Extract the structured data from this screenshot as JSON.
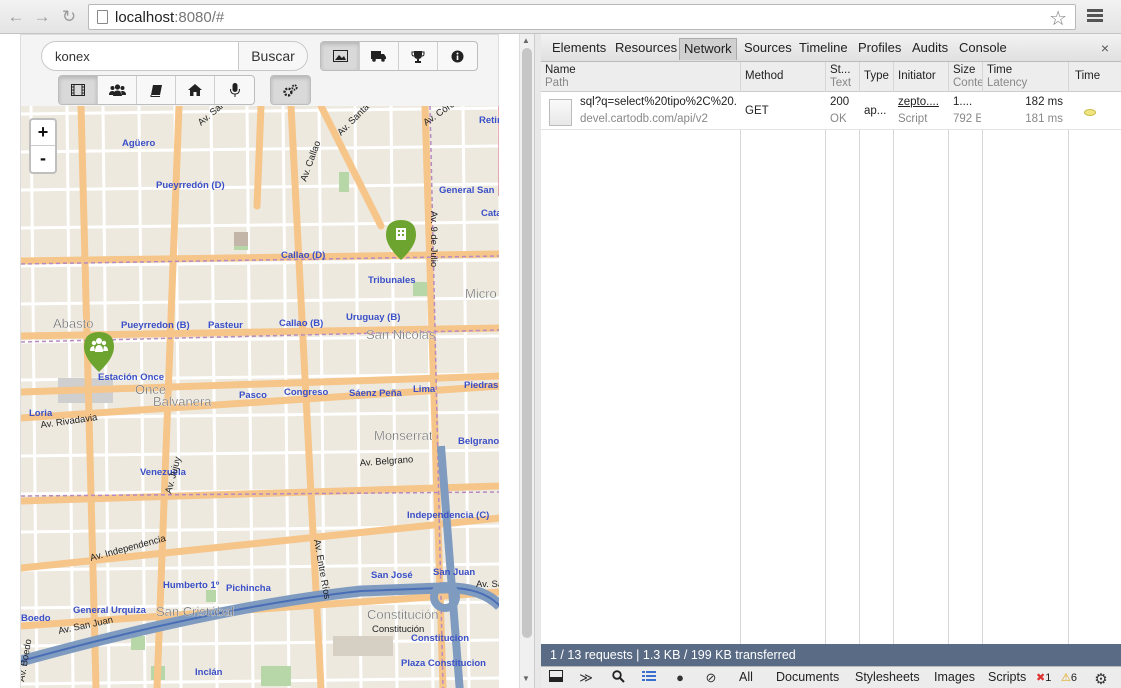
{
  "browser": {
    "url_host": "localhost",
    "url_rest": ":8080/#",
    "icons": [
      "back-arrow-icon",
      "forward-arrow-icon",
      "reload-icon",
      "page-icon",
      "star-icon",
      "menu-icon"
    ]
  },
  "app": {
    "search_value": "konex",
    "search_button": "Buscar",
    "top_buttons": [
      "image-icon",
      "truck-icon",
      "trophy-icon",
      "info-icon"
    ],
    "bottom_buttons": [
      "film-icon",
      "group-icon",
      "book-icon",
      "home-icon",
      "microphone-icon"
    ],
    "settings_button": "cogs-icon"
  },
  "map": {
    "zoom_in": "+",
    "zoom_out": "-",
    "labels": [
      {
        "t": "Agüero",
        "c": "blue"
      },
      {
        "t": "Pueyrredón (D)",
        "c": "blue"
      },
      {
        "t": "Av. Callao",
        "c": "road"
      },
      {
        "t": "Av. Santa Fe",
        "c": "road"
      },
      {
        "t": "Av. Córdoba",
        "c": "road"
      },
      {
        "t": "Callao (D)",
        "c": "blue"
      },
      {
        "t": "Tribunales",
        "c": "blue"
      },
      {
        "t": "Av. 9 de Julio",
        "c": "road"
      },
      {
        "t": "General San",
        "c": "blue"
      },
      {
        "t": "Cata",
        "c": "blue"
      },
      {
        "t": "Micro",
        "c": "place"
      },
      {
        "t": "Abasto",
        "c": "place"
      },
      {
        "t": "Pueyrredon (B)",
        "c": "blue"
      },
      {
        "t": "Pasteur",
        "c": "blue"
      },
      {
        "t": "Callao (B)",
        "c": "blue"
      },
      {
        "t": "Uruguay (B)",
        "c": "blue"
      },
      {
        "t": "San Nicolás",
        "c": "place"
      },
      {
        "t": "Estación Once",
        "c": "blue"
      },
      {
        "t": "Once",
        "c": "place"
      },
      {
        "t": "Balvanera",
        "c": "place"
      },
      {
        "t": "Pasco",
        "c": "blue"
      },
      {
        "t": "Congreso",
        "c": "blue"
      },
      {
        "t": "Sáenz Peña",
        "c": "blue"
      },
      {
        "t": "Lima",
        "c": "blue"
      },
      {
        "t": "Piedras",
        "c": "blue"
      },
      {
        "t": "Loria",
        "c": "blue"
      },
      {
        "t": "Av. Rivadavia",
        "c": "road"
      },
      {
        "t": "Monserrat",
        "c": "place"
      },
      {
        "t": "Belgrano",
        "c": "blue"
      },
      {
        "t": "Venezuela",
        "c": "blue"
      },
      {
        "t": "Av. Belgrano",
        "c": "road"
      },
      {
        "t": "Av. Jujuy",
        "c": "road"
      },
      {
        "t": "Av. Independencia",
        "c": "road"
      },
      {
        "t": "Independencia (C)",
        "c": "blue"
      },
      {
        "t": "Av. Entre Ríos",
        "c": "road"
      },
      {
        "t": "Humberto 1º",
        "c": "blue"
      },
      {
        "t": "Pichincha",
        "c": "blue"
      },
      {
        "t": "San José",
        "c": "blue"
      },
      {
        "t": "San Juan",
        "c": "blue"
      },
      {
        "t": "Av. San Ju",
        "c": "road"
      },
      {
        "t": "General Urquiza",
        "c": "blue"
      },
      {
        "t": "San Cristóbal",
        "c": "place"
      },
      {
        "t": "Av. San Juan",
        "c": "road"
      },
      {
        "t": "Boedo",
        "c": "blue"
      },
      {
        "t": "Av. Boedo",
        "c": "road"
      },
      {
        "t": "Constitución",
        "c": "place"
      },
      {
        "t": "Constitución",
        "c": "road"
      },
      {
        "t": "Constitucion",
        "c": "blue"
      },
      {
        "t": "Plaza Constitucion",
        "c": "blue"
      },
      {
        "t": "Inclán",
        "c": "blue"
      },
      {
        "t": "Retir",
        "c": "blue"
      },
      {
        "t": "Av. Santa Fe",
        "c": "road"
      }
    ]
  },
  "devtools": {
    "tabs": [
      "Elements",
      "Resources",
      "Network",
      "Sources",
      "Timeline",
      "Profiles",
      "Audits",
      "Console"
    ],
    "active_tab": "Network",
    "close": "×",
    "columns": [
      {
        "main": "Name",
        "sub": "Path"
      },
      {
        "main": "Method",
        "sub": ""
      },
      {
        "main": "St...",
        "sub": "Text"
      },
      {
        "main": "Type",
        "sub": ""
      },
      {
        "main": "Initiator",
        "sub": ""
      },
      {
        "main": "Size",
        "sub": "Conte"
      },
      {
        "main": "Time",
        "sub": "Latency"
      },
      {
        "main": "Time",
        "sub": ""
      }
    ],
    "request": {
      "name": "sql?q=select%20tipo%2C%20...",
      "path": "devel.cartodb.com/api/v2",
      "method": "GET",
      "status": "200",
      "status_text": "OK",
      "type": "ap...",
      "initiator": "zepto....",
      "initiator_sub": "Script",
      "size": "1....",
      "size_sub": "792 E",
      "time": "182 ms",
      "latency": "181 ms"
    },
    "summary": "1 / 13 requests  |  1.3 KB / 199 KB transferred",
    "filters": [
      "All",
      "Documents",
      "Stylesheets",
      "Images",
      "Scripts"
    ],
    "errors": "1",
    "warnings": "6",
    "bottom_icons": [
      "dock-icon",
      "console-icon",
      "search-icon",
      "list-icon",
      "record-icon",
      "clear-icon",
      "gear-icon"
    ]
  }
}
